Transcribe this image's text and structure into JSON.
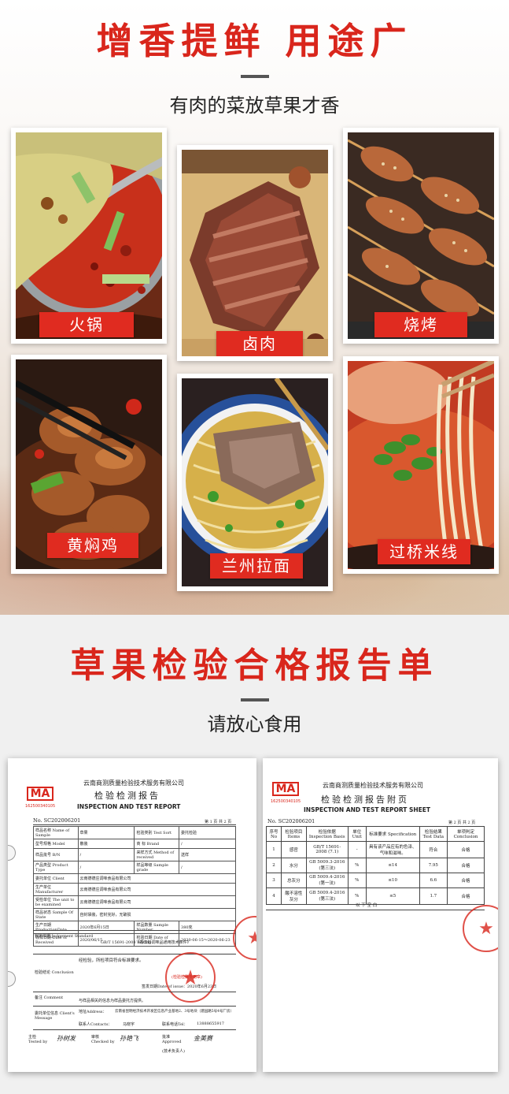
{
  "usage_section": {
    "title": "增香提鲜 用途广",
    "subtitle": "有肉的菜放草果才香",
    "dishes": [
      {
        "label": "火锅",
        "icon": "hotpot-photo"
      },
      {
        "label": "卤肉",
        "icon": "braised-meat-photo"
      },
      {
        "label": "烧烤",
        "icon": "bbq-skewers-photo"
      },
      {
        "label": "黄焖鸡",
        "icon": "braised-chicken-photo"
      },
      {
        "label": "兰州拉面",
        "icon": "lanzhou-noodles-photo"
      },
      {
        "label": "过桥米线",
        "icon": "rice-noodles-photo"
      }
    ]
  },
  "report_section": {
    "title": "草果检验合格报告单",
    "subtitle": "请放心食用",
    "report": {
      "mark": "MA",
      "mark_number": "162500340105",
      "org": "云南商测质量检验技术服务有限公司",
      "title_cn": "检验检测报告",
      "title_en": "INSPECTION AND TEST REPORT",
      "report_no": "No. SC202006201",
      "page": "第 1 页 共 2 页",
      "rows": [
        [
          "样品名称 Name of Sample",
          "草果",
          "检验类别 Test Sort",
          "委托检验"
        ],
        [
          "型号规格 Model",
          "散装",
          "商    标 Brand",
          "/"
        ],
        [
          "样品批号 B/N",
          "/",
          "来样方式 Method of received",
          "送样"
        ],
        [
          "产品类型 Product Type",
          "/",
          "样品等级 Sample grade",
          "/"
        ],
        [
          "委托单位 Client",
          "云南德德庄调味食品有限公司",
          "",
          ""
        ],
        [
          "生产单位 Manufacturer",
          "云南德德庄调味食品有限公司",
          "",
          ""
        ],
        [
          "受检单位 The unit to be examined",
          "云南德德庄调味食品有限公司",
          "",
          ""
        ],
        [
          "样品状态 Sample Of State",
          "自封袋装，密封完好，无破损",
          "",
          ""
        ],
        [
          "生产日期 ProductionDate",
          "2020年6月15日",
          "样品数量 Sample Number",
          "380克"
        ],
        [
          "收样日期 Date of Received",
          "2020/06/15",
          "检验日期 Date of Testing",
          "2020-06-15～2020-06-23"
        ]
      ],
      "standard_label": "判定依据 Judgement Standard",
      "standard": "GB/T 15691-2008《香辛料调味品通用技术条件》",
      "conclusion_label": "检验结论 Conclusion",
      "conclusion": "经检验，所检项目符合标准要求。",
      "issue_date": "签发日期Date of issue：2020年6月23日",
      "seal_text": "(检验检测专用章)",
      "remarks_label": "备注 Comment",
      "remarks": "与样品相关的信息为样品委托方提供。",
      "client_label": "委托单位信息 Client's Message",
      "address_label": "地址Address：",
      "address": "云南省昆明经济技术开发区信息产业基地2、3号地块（建园路5号4号厂房）",
      "contact_label": "联系人Contacts：",
      "contact": "马晓宇",
      "phone_label": "联系电话Tel：",
      "phone": "13888655917",
      "tested_by": "主检 Tested by",
      "checked_by": "审核 Checked by",
      "approved_by": "批准 Approved",
      "tech_head": "(技术负责人)",
      "sig_tested": "孙树发",
      "sig_checked": "孙艳飞",
      "sig_approved": "金美赛"
    },
    "sheet": {
      "mark": "MA",
      "mark_number": "162500340105",
      "org": "云南商测质量检验技术服务有限公司",
      "title_cn": "检验检测报告附页",
      "title_en": "INSPECTION AND TEST REPORT SHEET",
      "report_no": "No. SC202006201",
      "page": "第 2 页 共 2 页",
      "headers": [
        "序号 No",
        "检验项目 Items",
        "检验依据 Inspection Basis",
        "单位 Unit",
        "标准要求 Specification",
        "检验结果 Test Data",
        "单项判定 Conclusion"
      ],
      "rows": [
        [
          "1",
          "感官",
          "GB/T 15691-2008 (7.1)",
          "-",
          "具有该产品应有的色泽、气味和滋味。",
          "符合",
          "合格"
        ],
        [
          "2",
          "水分",
          "GB 5009.3-2016 (第三法)",
          "%",
          "≤14",
          "7.95",
          "合格"
        ],
        [
          "3",
          "总灰分",
          "GB 5009.4-2016 (第一法)",
          "%",
          "≤10",
          "6.6",
          "合格"
        ],
        [
          "4",
          "酸不溶性灰分",
          "GB 5009.4-2016 (第三法)",
          "%",
          "≤5",
          "1.7",
          "合格"
        ]
      ],
      "end_note": "以  下  空  白"
    }
  },
  "colors": {
    "accent": "#d9261c",
    "tag": "#e02b20"
  }
}
